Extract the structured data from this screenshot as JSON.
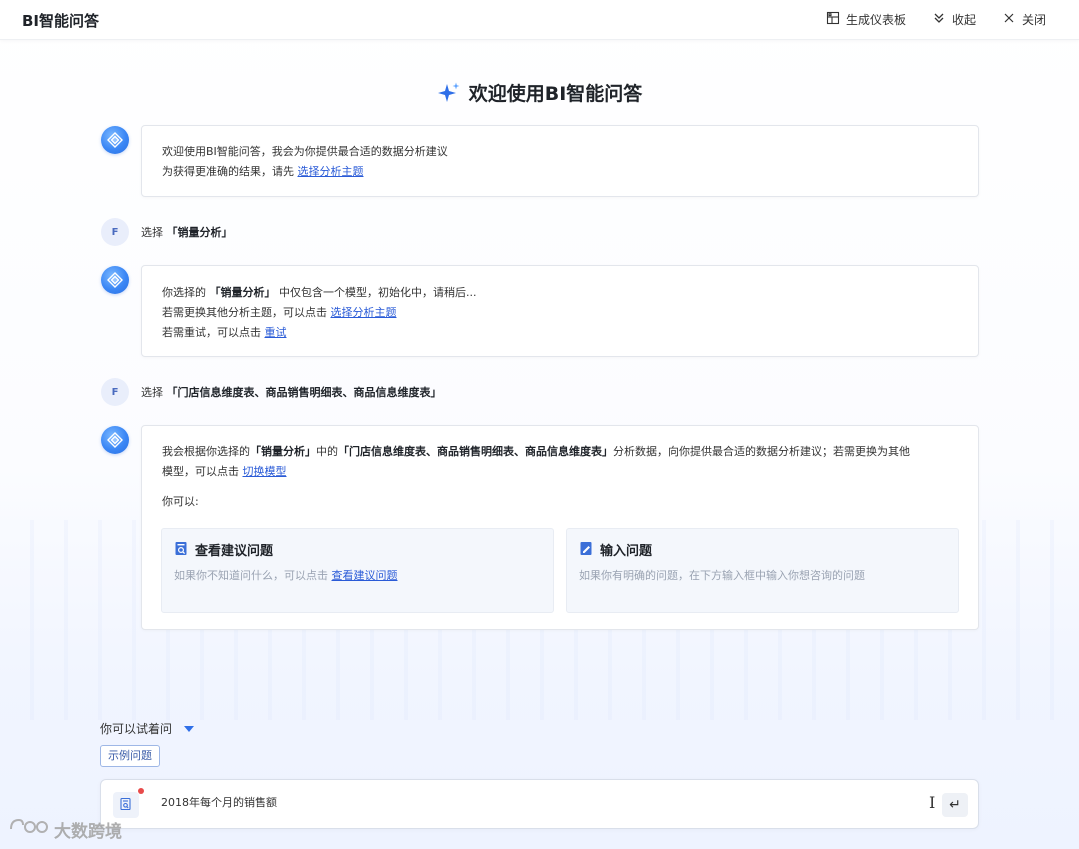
{
  "header": {
    "title": "BI智能问答",
    "dashboard_label": "生成仪表板",
    "collapse_label": "收起",
    "close_label": "关闭"
  },
  "welcome": {
    "title": "欢迎使用BI智能问答"
  },
  "messages": {
    "m1": {
      "line1": "欢迎使用BI智能问答，我会为你提供最合适的数据分析建议",
      "line2_prefix": "为获得更准确的结果，请先 ",
      "line2_link": "选择分析主题"
    },
    "u1": {
      "avatar": "F",
      "prefix": "选择 ",
      "value": "「销量分析」"
    },
    "m2": {
      "l1_prefix": "你选择的 ",
      "l1_em": "「销量分析」",
      "l1_suffix": " 中仅包含一个模型，初始化中，请稍后...",
      "l2_prefix": "若需更换其他分析主题，可以点击 ",
      "l2_link": "选择分析主题",
      "l3_prefix": "若需重试，可以点击 ",
      "l3_link": "重试"
    },
    "u2": {
      "avatar": "F",
      "prefix": "选择 ",
      "value": "「门店信息维度表、商品销售明细表、商品信息维度表」"
    },
    "m3": {
      "p1": "我会根据你选择的",
      "em1": "「销量分析」",
      "p2": "中的",
      "em2": "「门店信息维度表、商品销售明细表、商品信息维度表」",
      "p3": "分析数据，向你提供最合适的数据分析建议；若需更换为其他",
      "p4": "模型，可以点击 ",
      "link": "切换模型",
      "you_can": "你可以:",
      "card1_title": "查看建议问题",
      "card1_desc_prefix": "如果你不知道问什么，可以点击 ",
      "card1_link": "查看建议问题",
      "card2_title": "输入问题",
      "card2_desc": "如果你有明确的问题，在下方输入框中输入你想咨询的问题"
    }
  },
  "bottom": {
    "try_label": "你可以试着问",
    "example_tag": "示例问题",
    "input_value": "2018年每个月的销售额",
    "send_glyph": "↵"
  },
  "watermark": {
    "text": "大数跨境"
  },
  "colors": {
    "accent": "#2f6fe8",
    "link": "#2a5bd7"
  }
}
